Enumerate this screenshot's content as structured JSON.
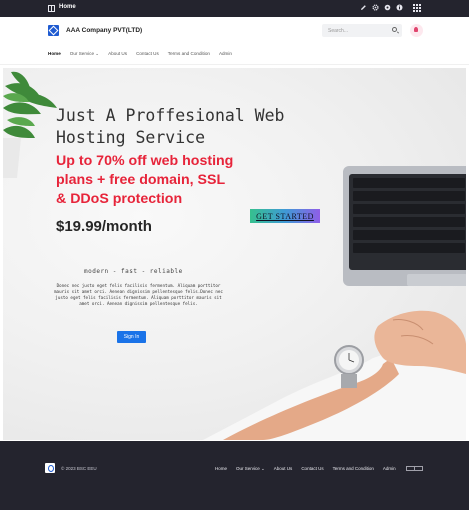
{
  "topbar": {
    "home_label": "Home",
    "icons": [
      "edit-icon",
      "settings-icon",
      "globe-icon",
      "info-icon",
      "apps-grid-icon"
    ]
  },
  "header": {
    "company_name": "AAA Company PVT(LTD)",
    "search_placeholder": "Search...",
    "nav": [
      {
        "label": "Home",
        "active": true
      },
      {
        "label": "Our Service ⌄"
      },
      {
        "label": "About Us"
      },
      {
        "label": "Contact Us"
      },
      {
        "label": "Terms and Condition"
      },
      {
        "label": "Admin"
      }
    ]
  },
  "hero": {
    "title_line1": "Just A Proffesional Web",
    "title_line2": "Hosting Service",
    "offer_line1": "Up to 70% off web hosting",
    "offer_line2": "plans + free domain, SSL",
    "offer_line3": "& DDoS protection",
    "price": "$19.99/month",
    "cta_label": "GET STARTED",
    "tagline": "modern - fast - reliable",
    "body_text": "Donec nec justo eget felis facilisis fermentum. Aliquam porttitor mauris sit amet orci. Aenean dignissim pellentesque felis.Donec nec justo eget felis facilisis fermentum. Aliquam porttitor mauris sit amet orci. Aenean dignissim pellentesque felis.",
    "signin_label": "Sign In"
  },
  "footer": {
    "copyright": "© 2023 BSC EEU",
    "nav": [
      "Home",
      "Our Service ⌄",
      "About Us",
      "Contact Us",
      "Terms and Condition",
      "Admin"
    ]
  },
  "colors": {
    "dark_bar": "#24242e",
    "accent_blue": "#1a73e8",
    "offer_red": "#e7243a"
  }
}
